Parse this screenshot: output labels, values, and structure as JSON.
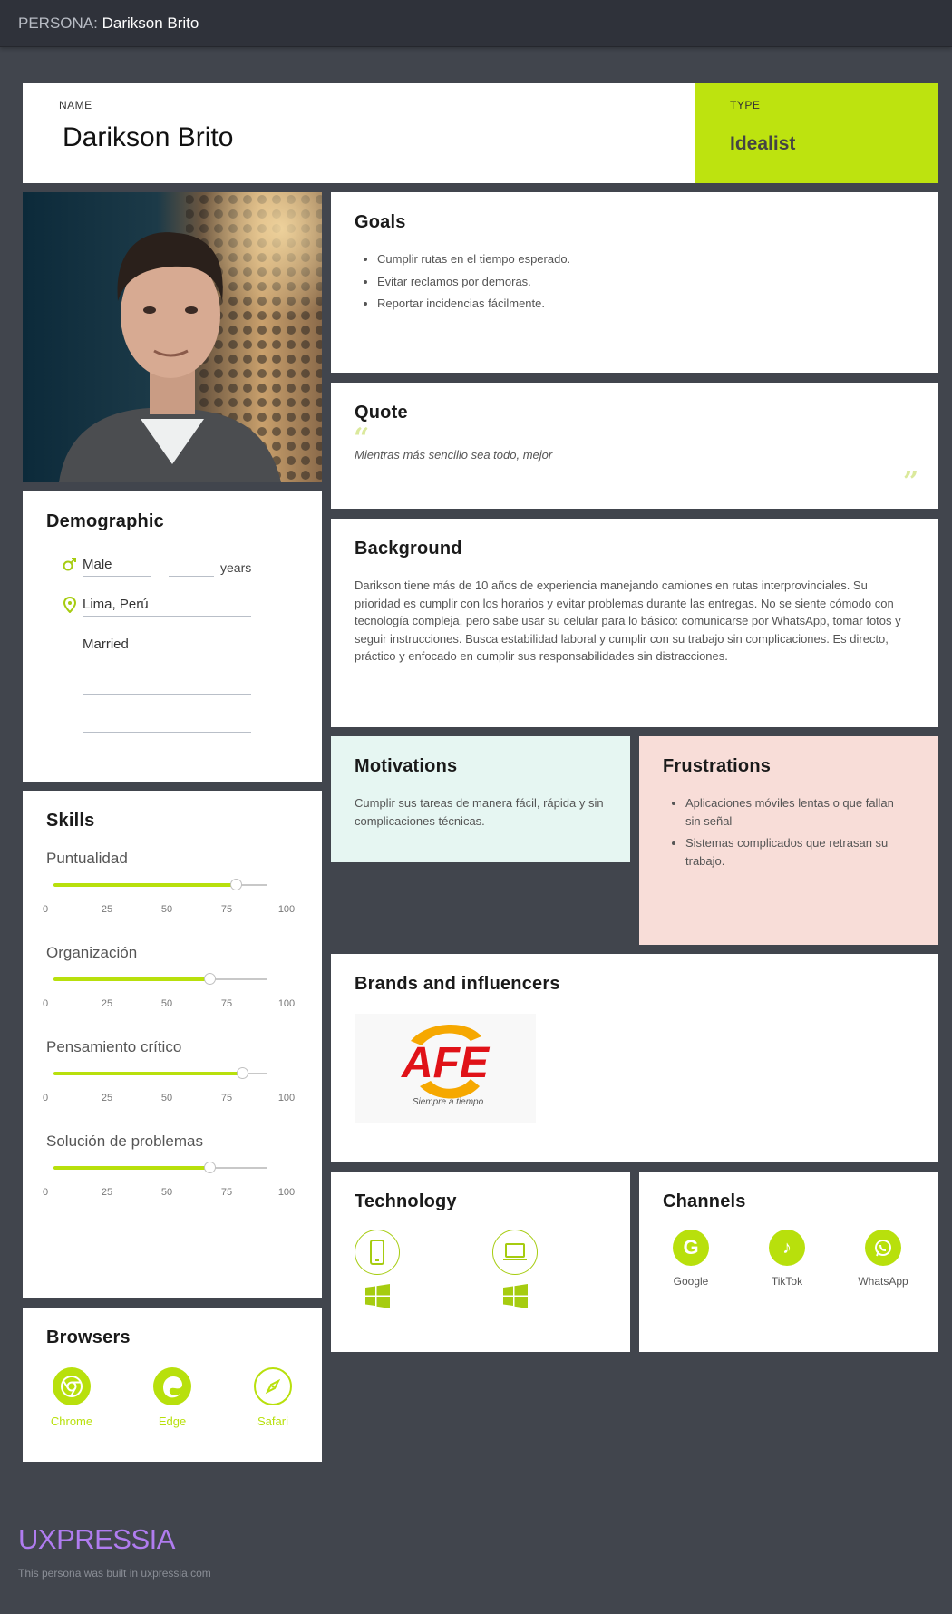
{
  "topbar": {
    "prefix": "PERSONA:",
    "name": "Darikson Brito"
  },
  "name_card": {
    "label": "NAME",
    "value": "Darikson Brito"
  },
  "type_card": {
    "label": "TYPE",
    "value": "Idealist"
  },
  "goals": {
    "title": "Goals",
    "items": [
      "Cumplir rutas en el tiempo esperado.",
      "Evitar reclamos por demoras.",
      "Reportar incidencias fácilmente."
    ]
  },
  "quote": {
    "title": "Quote",
    "text": "Mientras más sencillo sea todo, mejor"
  },
  "background": {
    "title": "Background",
    "text": "Darikson tiene más de 10 años de experiencia manejando camiones en rutas interprovinciales. Su prioridad es cumplir con los horarios y evitar problemas durante las entregas. No se siente cómodo con tecnología compleja, pero sabe usar su celular para lo básico: comunicarse por WhatsApp, tomar fotos y seguir instrucciones. Busca estabilidad laboral y cumplir con su trabajo sin complicaciones. Es directo, práctico y enfocado en cumplir sus responsabilidades sin distracciones."
  },
  "demographic": {
    "title": "Demographic",
    "gender": "Male",
    "age": "",
    "age_unit": "years",
    "location": "Lima, Perú",
    "status": "Married",
    "extra1": "",
    "extra2": ""
  },
  "motivations": {
    "title": "Motivations",
    "text": "Cumplir sus tareas de manera fácil, rápida y sin complicaciones técnicas."
  },
  "frustrations": {
    "title": "Frustrations",
    "items": [
      "Aplicaciones móviles lentas o que fallan sin señal",
      "Sistemas complicados que retrasan su trabajo."
    ]
  },
  "skills": {
    "title": "Skills",
    "ticks": [
      "0",
      "25",
      "50",
      "75",
      "100"
    ],
    "items": [
      {
        "name": "Puntualidad",
        "value": 85
      },
      {
        "name": "Organización",
        "value": 73
      },
      {
        "name": "Pensamiento crítico",
        "value": 88
      },
      {
        "name": "Solución de problemas",
        "value": 73
      }
    ]
  },
  "brands": {
    "title": "Brands and influencers",
    "logo_text": "AFE",
    "logo_tagline": "Siempre a tiempo"
  },
  "technology": {
    "title": "Technology",
    "items": [
      "phone-icon",
      "laptop-icon"
    ],
    "os": [
      "windows-icon",
      "windows-icon"
    ]
  },
  "channels": {
    "title": "Channels",
    "items": [
      "Google",
      "TikTok",
      "WhatsApp"
    ]
  },
  "browsers": {
    "title": "Browsers",
    "items": [
      "Chrome",
      "Edge",
      "Safari"
    ]
  },
  "footer": {
    "brand": "UXPRESSIA",
    "note": "This persona was built in uxpressia.com"
  },
  "colors": {
    "accent": "#b8e00c",
    "background": "#41454d",
    "motivations_bg": "#e6f6f2",
    "frustrations_bg": "#f8ddd8",
    "brand_purple": "#b07cf0"
  }
}
